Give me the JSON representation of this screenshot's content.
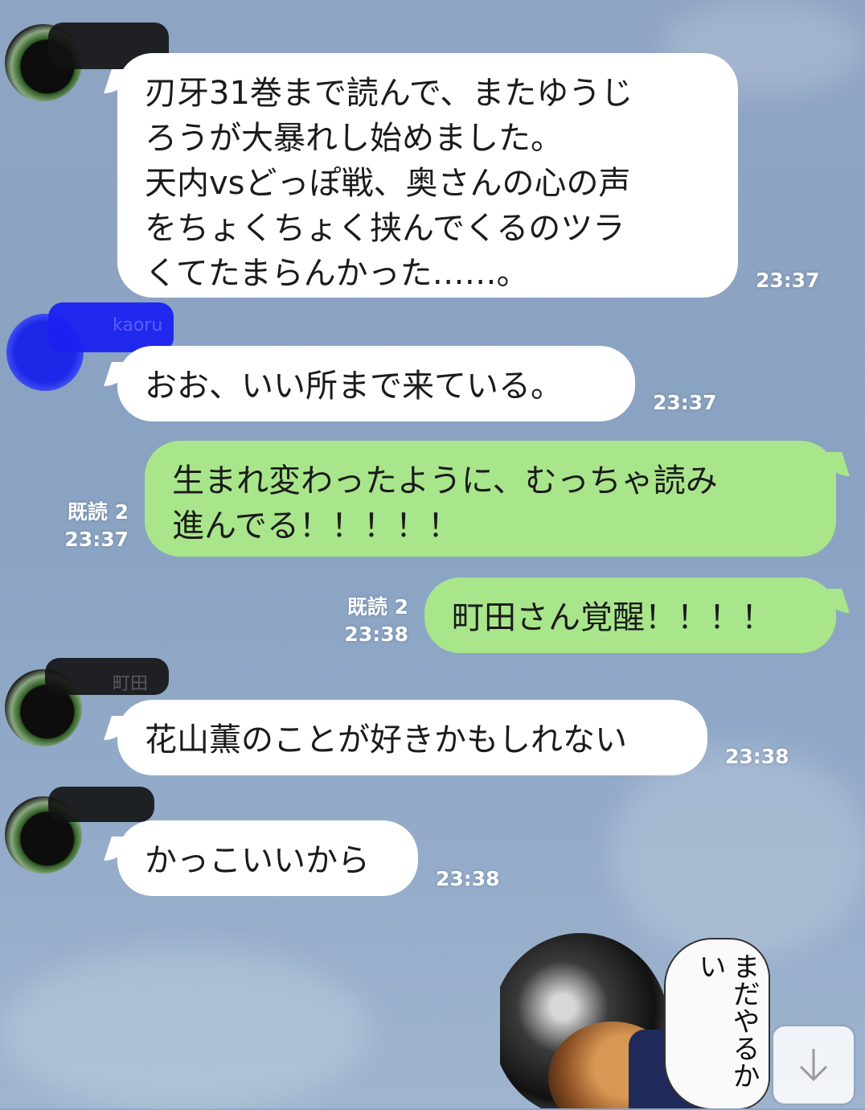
{
  "messages": [
    {
      "text": "刃牙31巻まで読んで、またゆうじ\nろうが大暴れし始めました。\n天内vsどっぽ戦、奥さんの心の声\nをちょくちょく挟んでくるのツラ\nくてたまらんかった……。",
      "time": "23:37"
    },
    {
      "text": "おお、いい所まで来ている。",
      "time": "23:37"
    },
    {
      "text": "生まれ変わったように、むっちゃ読み\n進んでる！！！！！",
      "time": "23:37",
      "read": "既読 2"
    },
    {
      "text": "町田さん覚醒！！！！",
      "time": "23:38",
      "read": "既読 2"
    },
    {
      "text": "花山薫のことが好きかもしれない",
      "time": "23:38"
    },
    {
      "text": "かっこいいから",
      "time": "23:38"
    }
  ],
  "senders": [
    "町田",
    "kaoru",
    "町田",
    "町田"
  ],
  "sticker": {
    "text": "まだやるかい"
  },
  "icons": {
    "scroll": "arrow-down-icon"
  },
  "colors": {
    "incoming": "#ffffff",
    "outgoing": "#a9e68b",
    "background": "#8ea4c3"
  }
}
